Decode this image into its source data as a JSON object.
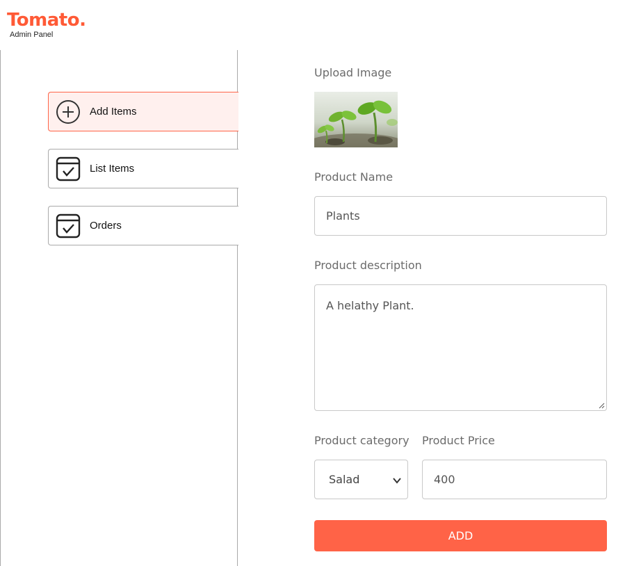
{
  "header": {
    "logo_title": "Tomato.",
    "logo_subtitle": "Admin Panel"
  },
  "sidebar": {
    "items": [
      {
        "label": "Add Items",
        "icon": "add-circle-icon",
        "active": true
      },
      {
        "label": "List Items",
        "icon": "checklist-icon",
        "active": false
      },
      {
        "label": "Orders",
        "icon": "checklist-icon",
        "active": false
      }
    ]
  },
  "form": {
    "upload_label": "Upload Image",
    "upload_image": "plant-seedlings-image",
    "name_label": "Product Name",
    "name_value": "Plants",
    "description_label": "Product description",
    "description_value": "A helathy Plant.",
    "category_label": "Product category",
    "category_value": "Salad",
    "price_label": "Product Price",
    "price_value": "400",
    "submit_label": "ADD"
  },
  "colors": {
    "accent": "#ff6347",
    "active_bg": "#fff0ee",
    "label": "#6b6b6b",
    "border": "#a9a9a9"
  }
}
